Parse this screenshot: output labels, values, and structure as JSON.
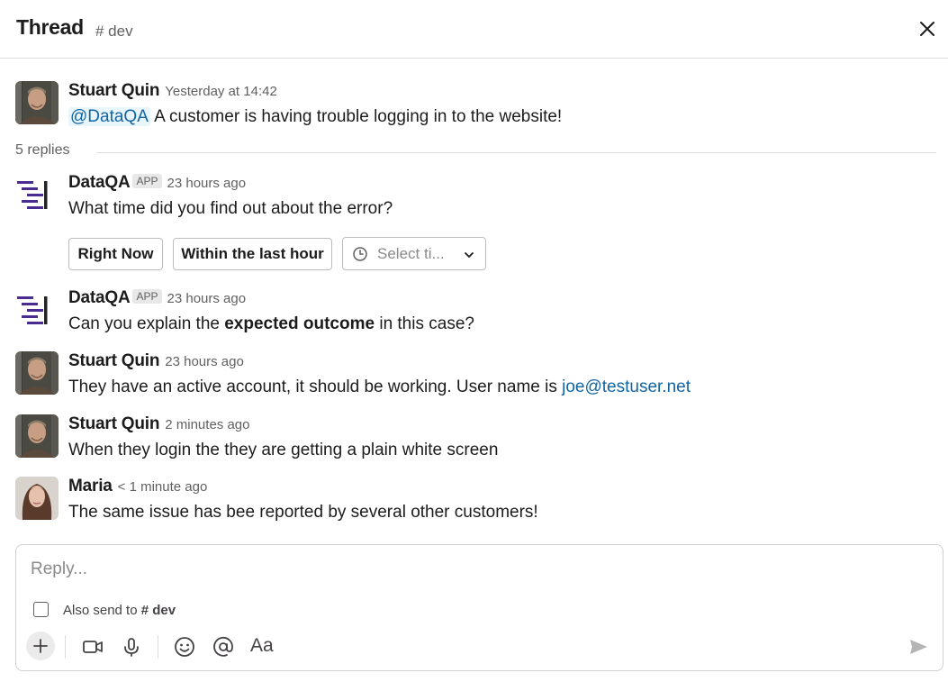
{
  "header": {
    "title": "Thread",
    "channel": "# dev"
  },
  "parent": {
    "author": "Stuart Quin",
    "time": "Yesterday at 14:42",
    "mention": "@DataQA",
    "text": " A customer is having trouble logging in to the website!"
  },
  "replies_label": "5 replies",
  "messages": [
    {
      "author": "DataQA",
      "badge": "APP",
      "time": "23 hours ago",
      "text": "What time did you find out about the error?",
      "buttons": [
        "Right Now",
        "Within the last hour"
      ],
      "select_placeholder": "Select ti..."
    },
    {
      "author": "DataQA",
      "badge": "APP",
      "time": "23 hours ago",
      "text_before": "Can you explain the ",
      "text_bold": "expected outcome",
      "text_after": " in this case?"
    },
    {
      "author": "Stuart Quin",
      "time": "23 hours ago",
      "text_before": "They have an active account, it should be working. User name is ",
      "link": "joe@testuser.net"
    },
    {
      "author": "Stuart Quin",
      "time": "2 minutes ago",
      "text": "When they login the they are getting a plain white screen"
    },
    {
      "author": "Maria",
      "time": "< 1 minute ago",
      "text": "The same issue has bee reported by several other customers!"
    }
  ],
  "composer": {
    "placeholder": "Reply...",
    "also_send_prefix": "Also send to ",
    "also_send_channel": "# dev",
    "format_label": "Aa"
  },
  "icons": [
    "close-icon",
    "clock-icon",
    "chevron-down-icon",
    "plus-icon",
    "video-icon",
    "microphone-icon",
    "emoji-icon",
    "at-mention-icon",
    "send-icon"
  ],
  "colors": {
    "dataqa_brand": "#4a2b8f",
    "link": "#1264a3",
    "mention_bg": "#e8f5fa"
  }
}
